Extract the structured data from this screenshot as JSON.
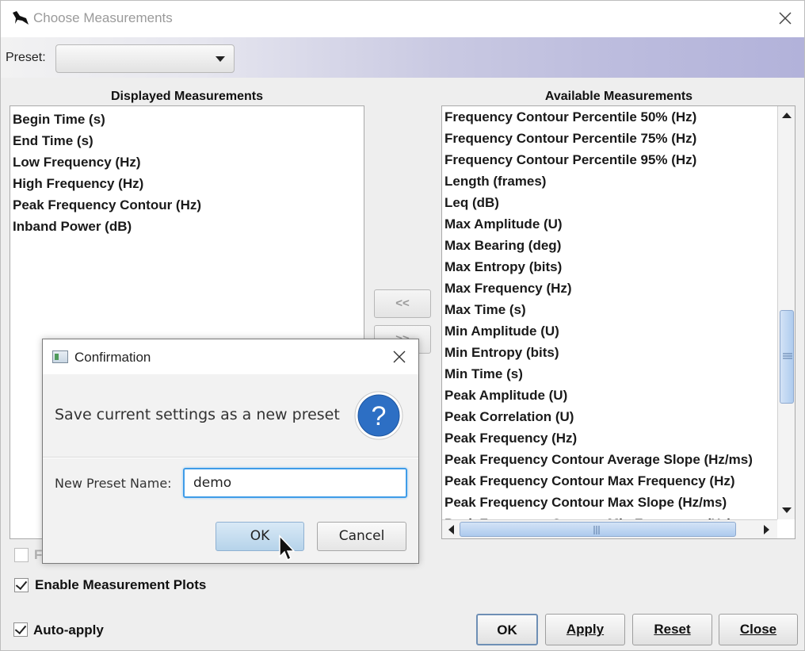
{
  "window": {
    "title": "Choose Measurements"
  },
  "preset": {
    "label": "Preset:",
    "value": ""
  },
  "displayed": {
    "header": "Displayed Measurements",
    "items": [
      "Begin Time (s)",
      "End Time (s)",
      "Low Frequency (Hz)",
      "High Frequency (Hz)",
      "Peak Frequency Contour (Hz)",
      "Inband Power (dB)"
    ]
  },
  "available": {
    "header": "Available Measurements",
    "items": [
      "Frequency Contour Percentile 50% (Hz)",
      "Frequency Contour Percentile 75% (Hz)",
      "Frequency Contour Percentile 95% (Hz)",
      "Length (frames)",
      "Leq (dB)",
      "Max Amplitude (U)",
      "Max Bearing (deg)",
      "Max Entropy (bits)",
      "Max Frequency (Hz)",
      "Max Time (s)",
      "Min Amplitude (U)",
      "Min Entropy (bits)",
      "Min Time (s)",
      "Peak Amplitude (U)",
      "Peak Correlation (U)",
      "Peak Frequency (Hz)",
      "Peak Frequency Contour Average Slope (Hz/ms)",
      "Peak Frequency Contour Max Frequency (Hz)",
      "Peak Frequency Contour Max Slope (Hz/ms)",
      "Peak Frequency Contour Min Frequency (Hz)"
    ]
  },
  "move": {
    "left_label": "<<",
    "right_label": ">>"
  },
  "options": {
    "hidden_check_label": "F",
    "enable_plots_label": "Enable Measurement Plots",
    "enable_plots_checked": true,
    "auto_apply_label": "Auto-apply",
    "auto_apply_checked": true
  },
  "buttons": {
    "ok": "OK",
    "apply": "Apply",
    "reset": "Reset",
    "close": "Close"
  },
  "confirm": {
    "title": "Confirmation",
    "message": "Save current settings as a new preset",
    "name_label": "New Preset Name:",
    "name_value": "demo",
    "ok": "OK",
    "cancel": "Cancel"
  }
}
